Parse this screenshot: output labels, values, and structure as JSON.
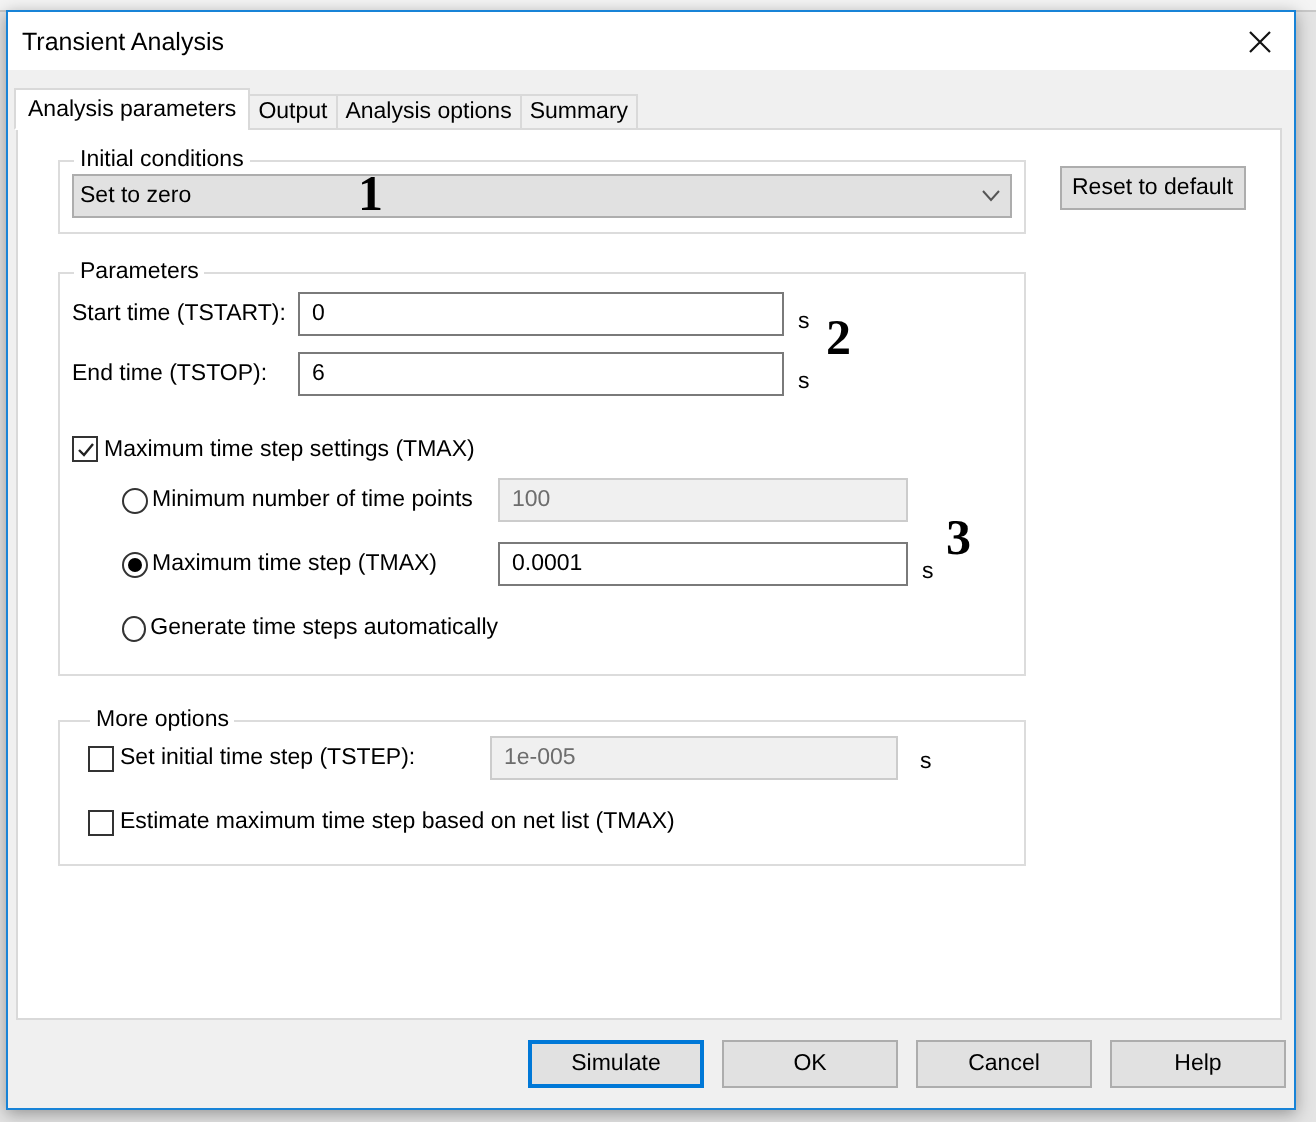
{
  "window": {
    "title": "Transient Analysis"
  },
  "tabs": [
    {
      "label": "Analysis parameters",
      "selected": true
    },
    {
      "label": "Output",
      "selected": false
    },
    {
      "label": "Analysis options",
      "selected": false
    },
    {
      "label": "Summary",
      "selected": false
    }
  ],
  "initial_conditions": {
    "title": "Initial conditions",
    "value": "Set to zero"
  },
  "reset_button": "Reset to default",
  "parameters": {
    "title": "Parameters",
    "fields": [
      {
        "label": "Start time (TSTART):",
        "value": "0",
        "unit": "s"
      },
      {
        "label": "End time (TSTOP):",
        "value": "6",
        "unit": "s"
      }
    ],
    "tmax_settings": {
      "label": "Maximum time step settings (TMAX)",
      "checked": true
    },
    "options": [
      {
        "label": "Minimum number of time points",
        "selected": false,
        "value": "100",
        "disabled": true
      },
      {
        "label": "Maximum time step (TMAX)",
        "selected": true,
        "value": "0.0001",
        "unit": "s",
        "disabled": false
      },
      {
        "label": "Generate time steps automatically",
        "selected": false
      }
    ]
  },
  "more_options": {
    "title": "More options",
    "items": [
      {
        "label": "Set initial time step (TSTEP):",
        "checked": false,
        "value": "1e-005",
        "unit": "s",
        "disabled": true
      },
      {
        "label": "Estimate maximum time step based on net list (TMAX)",
        "checked": false
      }
    ]
  },
  "annotations": [
    "1",
    "2",
    "3"
  ],
  "buttons": [
    {
      "label": "Simulate",
      "default": true
    },
    {
      "label": "OK",
      "default": false
    },
    {
      "label": "Cancel",
      "default": false
    },
    {
      "label": "Help",
      "default": false
    }
  ]
}
